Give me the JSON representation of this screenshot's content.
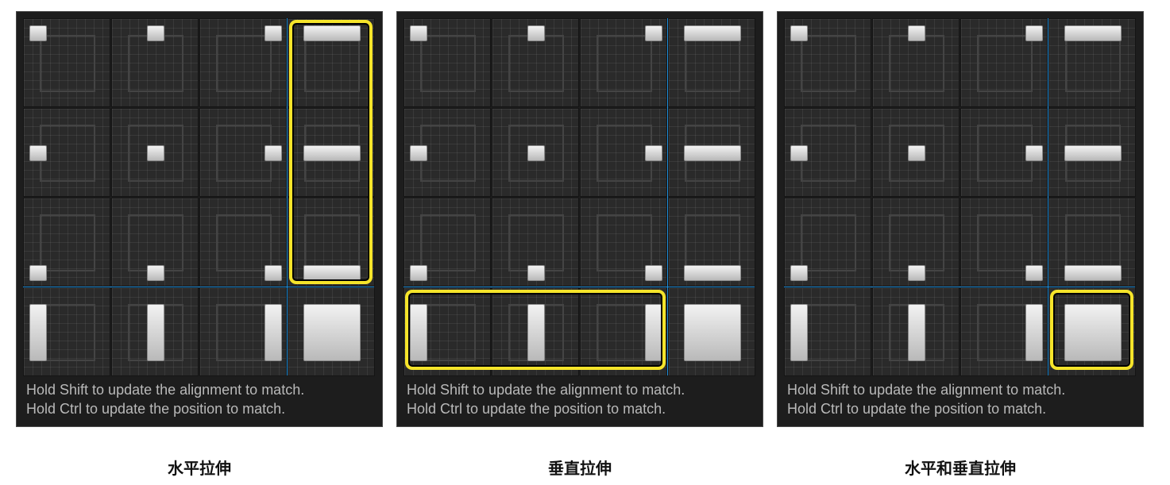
{
  "panels": [
    {
      "hint_line1": "Hold Shift to update the alignment to match.",
      "hint_line2": "Hold Ctrl to update the position to match.",
      "caption": "水平拉伸",
      "highlighted": "right-column"
    },
    {
      "hint_line1": "Hold Shift to update the alignment to match.",
      "hint_line2": "Hold Ctrl to update the position to match.",
      "caption": "垂直拉伸",
      "highlighted": "bottom-row"
    },
    {
      "hint_line1": "Hold Shift to update the alignment to match.",
      "hint_line2": "Hold Ctrl to update the position to match.",
      "caption": "水平和垂直拉伸",
      "highlighted": "bottom-right-cell"
    }
  ],
  "anchor_grid": {
    "rows": [
      "top",
      "center",
      "bottom",
      "stretch"
    ],
    "columns": [
      "left",
      "center",
      "right",
      "stretch"
    ]
  },
  "colors": {
    "highlight": "#f5e42a",
    "divider": "#1f8fdc",
    "panel_bg": "#1d1d1d"
  }
}
